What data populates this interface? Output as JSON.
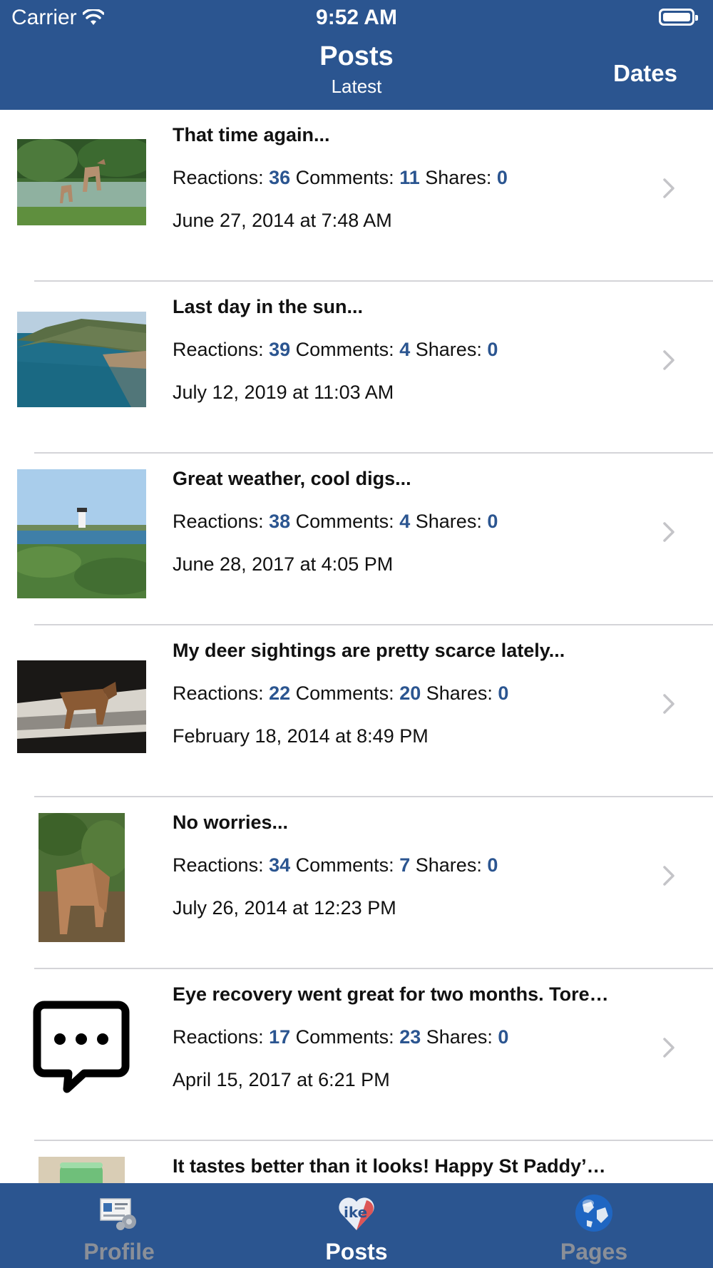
{
  "status_bar": {
    "carrier": "Carrier",
    "time": "9:52 AM"
  },
  "nav": {
    "title": "Posts",
    "subtitle": "Latest",
    "right_button": "Dates"
  },
  "stats_labels": {
    "reactions": "Reactions:",
    "comments": "Comments:",
    "shares": "Shares:"
  },
  "posts": [
    {
      "title": "That time again...",
      "reactions": "36",
      "comments": "11",
      "shares": "0",
      "date": "June 27, 2014 at 7:48 AM",
      "thumbnail": "deer-photo"
    },
    {
      "title": "Last day in the sun...",
      "reactions": "39",
      "comments": "4",
      "shares": "0",
      "date": "July 12, 2019 at 11:03 AM",
      "thumbnail": "beach-photo"
    },
    {
      "title": "Great weather, cool digs...",
      "reactions": "38",
      "comments": "4",
      "shares": "0",
      "date": "June 28, 2017 at 4:05 PM",
      "thumbnail": "lighthouse-photo"
    },
    {
      "title": "My deer sightings are pretty scarce lately...",
      "reactions": "22",
      "comments": "20",
      "shares": "0",
      "date": "February 18, 2014 at 8:49 PM",
      "thumbnail": "coyote-photo"
    },
    {
      "title": "No worries...",
      "reactions": "34",
      "comments": "7",
      "shares": "0",
      "date": "July 26, 2014 at 12:23 PM",
      "thumbnail": "fawn-photo"
    },
    {
      "title": "Eye recovery went great for two months. Tore…",
      "reactions": "17",
      "comments": "23",
      "shares": "0",
      "date": "April 15, 2017 at 6:21 PM",
      "thumbnail": "chat-bubble-icon"
    },
    {
      "title": "It tastes better than it looks! Happy St Paddy’…",
      "thumbnail": "drink-photo"
    }
  ],
  "tabs": [
    {
      "label": "Profile",
      "icon": "profile-card-icon",
      "active": false
    },
    {
      "label": "Posts",
      "icon": "like-heart-icon",
      "active": true
    },
    {
      "label": "Pages",
      "icon": "globe-icon",
      "active": false
    }
  ],
  "colors": {
    "brand_blue": "#2b5590",
    "stat_number": "#2b5590",
    "inactive_tab": "#8a8f98"
  }
}
